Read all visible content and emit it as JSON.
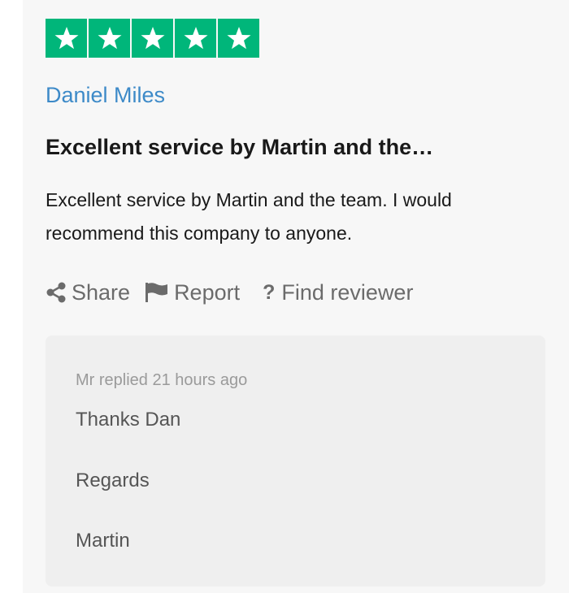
{
  "rating": {
    "stars": 5,
    "max": 5,
    "color": "#00b67a",
    "icon": "star-icon"
  },
  "review": {
    "reviewer_name": "Daniel Miles",
    "reviewer_color": "#3d8ac8",
    "title": "Excellent service by Martin and the…",
    "body": "Excellent service by Martin and the team. I would recommend this company to anyone."
  },
  "actions": {
    "share": {
      "label": "Share",
      "icon": "share-icon"
    },
    "report": {
      "label": "Report",
      "icon": "flag-icon"
    },
    "find_reviewer": {
      "label": "Find reviewer",
      "icon": "question-icon",
      "glyph": "?"
    }
  },
  "reply": {
    "meta": "Mr replied 21 hours ago",
    "lines": [
      "Thanks Dan",
      "Regards",
      "Martin"
    ]
  }
}
